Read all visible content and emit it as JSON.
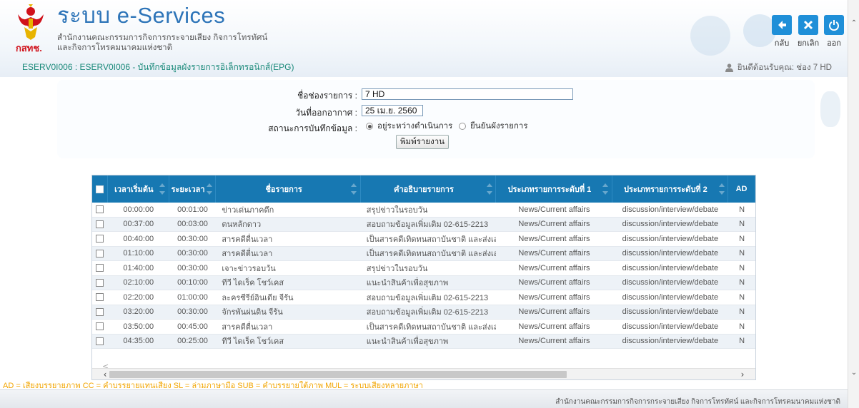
{
  "header": {
    "system_title": "ระบบ e-Services",
    "org_line1": "สำนักงานคณะกรรมการกิจการกระจายเสียง กิจการโทรทัศน์",
    "org_line2": "และกิจการโทรคมนาคมแห่งชาติ",
    "agency_abbr": "กสทช.",
    "page_path": "ESERV0I006 : ESERV0I006 - บันทึกข้อมูลผังรายการอิเล็กทรอนิกส์(EPG)",
    "user_greeting": "ยินดีต้อนรับคุณ: ช่อง 7 HD",
    "toolbar": {
      "back_label": "กลับ",
      "cancel_label": "ยกเลิก",
      "exit_label": "ออก"
    }
  },
  "form": {
    "channel_label": "ชื่อช่องรายการ :",
    "channel_value": "7 HD",
    "date_label": "วันที่ออกอากาศ :",
    "date_value": "25 เม.ย. 2560",
    "status_label": "สถานะการบันทึกข้อมูล :",
    "status_options": [
      "อยู่ระหว่างดำเนินการ",
      "ยืนยันผังรายการ"
    ],
    "status_selected": 0,
    "print_button": "พิมพ์รายงาน"
  },
  "table": {
    "columns": [
      "เวลาเริ่มต้น",
      "ระยะเวลา",
      "ชื่อรายการ",
      "คำอธิบายรายการ",
      "ประเภทรายการระดับที่ 1",
      "ประเภทรายการระดับที่ 2",
      "AD"
    ],
    "rows": [
      [
        "00:00:00",
        "00:01:00",
        "ข่าวเด่นภาคดึก",
        "สรุปข่าวในรอบวัน",
        "News/Current affairs",
        "discussion/interview/debate",
        "N"
      ],
      [
        "00:37:00",
        "00:03:00",
        "ตนหลักดาว",
        "สอบถามข้อมูลเพิ่มเติม 02-615-2213",
        "News/Current affairs",
        "discussion/interview/debate",
        "N"
      ],
      [
        "00:40:00",
        "00:30:00",
        "สารคดีตื่นเวลา",
        "เป็นสารคดีเทิดทนสถาบันชาติ และส่งเสริมวิถีฯ",
        "News/Current affairs",
        "discussion/interview/debate",
        "N"
      ],
      [
        "01:10:00",
        "00:30:00",
        "สารคดีตื่นเวลา",
        "เป็นสารคดีเทิดทนสถาบันชาติ และส่งเสริมวิถีฯ",
        "News/Current affairs",
        "discussion/interview/debate",
        "N"
      ],
      [
        "01:40:00",
        "00:30:00",
        "เจาะข่าวรอบวัน",
        "สรุปข่าวในรอบวัน",
        "News/Current affairs",
        "discussion/interview/debate",
        "N"
      ],
      [
        "02:10:00",
        "00:10:00",
        "ทีวี ไดเร็ค โชว์เคส",
        "แนะนำสินค้าเพื่อสุขภาพ",
        "News/Current affairs",
        "discussion/interview/debate",
        "N"
      ],
      [
        "02:20:00",
        "01:00:00",
        "ละครซีรีย์อินเดีย จีรัน",
        "สอบถามข้อมูลเพิ่มเติม 02-615-2213",
        "News/Current affairs",
        "discussion/interview/debate",
        "N"
      ],
      [
        "03:20:00",
        "00:30:00",
        "จักรพันผ่นดิน จีรัน",
        "สอบถามข้อมูลเพิ่มเติม 02-615-2213",
        "News/Current affairs",
        "discussion/interview/debate",
        "N"
      ],
      [
        "03:50:00",
        "00:45:00",
        "สารคดีตื่นเวลา",
        "เป็นสารคดีเทิดทนสถาบันชาติ และส่งเสริมวิถีฯ",
        "News/Current affairs",
        "discussion/interview/debate",
        "N"
      ],
      [
        "04:35:00",
        "00:25:00",
        "ทีวี ไดเร็ค โชว์เคส",
        "แนะนำสินค้าเพื่อสุขภาพ",
        "News/Current affairs",
        "discussion/interview/debate",
        "N"
      ]
    ]
  },
  "legend_line": "AD = เสียงบรรยายภาพ CC = คำบรรยายแทนเสียง SL = ล่ามภาษามือ SUB = คำบรรยายใต้ภาพ MUL = ระบบเสียงหลายภาษา",
  "footer_text": "สำนักงานคณะกรรมการกิจการกระจายเสียง กิจการโทรทัศน์ และกิจการโทรคมนาคมแห่งชาติ",
  "colors": {
    "brand_blue": "#2d74b8",
    "header_row": "#1778b2",
    "path_green": "#1b8a7a",
    "legend_orange": "#f2a500",
    "agency_red": "#d0121b"
  }
}
